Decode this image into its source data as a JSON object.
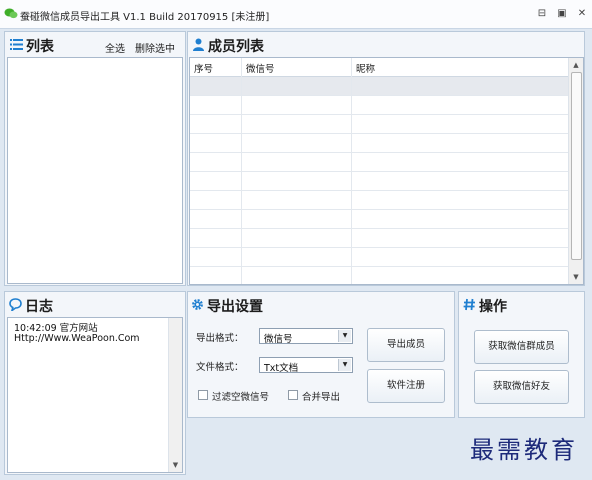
{
  "window": {
    "title": "蚕碰微信成员导出工具 V1.1 Build 20170915   [未注册]",
    "minimize_icon": "minimize-icon",
    "restore_icon": "restore-icon",
    "close_icon": "close-icon"
  },
  "list_panel": {
    "title": "列表",
    "select_all": "全选",
    "delete_selected": "删除选中"
  },
  "members_panel": {
    "title": "成员列表",
    "columns": [
      "序号",
      "微信号",
      "昵称"
    ]
  },
  "log_panel": {
    "title": "日志",
    "lines": [
      "10:42:09    官方网站",
      "Http://Www.WeaPoon.Com"
    ]
  },
  "export_panel": {
    "title": "导出设置",
    "format_label": "导出格式：",
    "format_value": "微信号",
    "file_label": "文件格式：",
    "file_value": "Txt文档",
    "filter_empty_label": "过滤空微信号",
    "merge_export_label": "合并导出",
    "export_button": "导出成员",
    "register_button": "软件注册"
  },
  "ops_panel": {
    "title": "操作",
    "get_group_members": "获取微信群成员",
    "get_friends": "获取微信好友"
  },
  "watermark": "最需教育",
  "colors": {
    "accent": "#1f7fd0",
    "panel_bg": "#f3f6fa",
    "window_bg": "#dfe8f2"
  }
}
